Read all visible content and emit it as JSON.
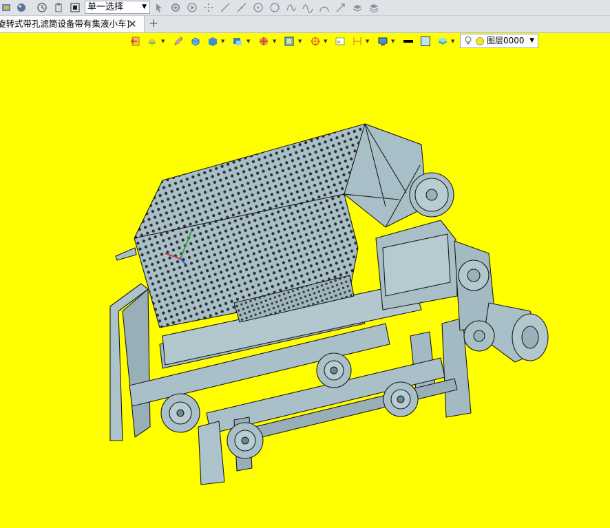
{
  "toolbar": {
    "selection_mode": "单一选择",
    "icons": [
      "app-icon",
      "palette-icon",
      "history-icon",
      "clipboard-icon",
      "stop-icon",
      "pointer-icon",
      "filter-icon",
      "play-icon",
      "snap-icon",
      "line-icon",
      "line2-icon",
      "circle-icon",
      "circle2-icon",
      "curve-icon",
      "wave-icon",
      "arc-icon",
      "arrow-icon",
      "layers-icon",
      "layers2-icon"
    ]
  },
  "tabs": {
    "active_label": "旋转式带孔滤筒设备带有集液小车]",
    "close_glyph": "✕",
    "new_tab_glyph": "+"
  },
  "view_toolbar": {
    "layer_name": "图层0000"
  },
  "colors": {
    "background": "#ffff00",
    "model_fill": "#a9bfc7",
    "model_edge": "#1a1a1a"
  }
}
